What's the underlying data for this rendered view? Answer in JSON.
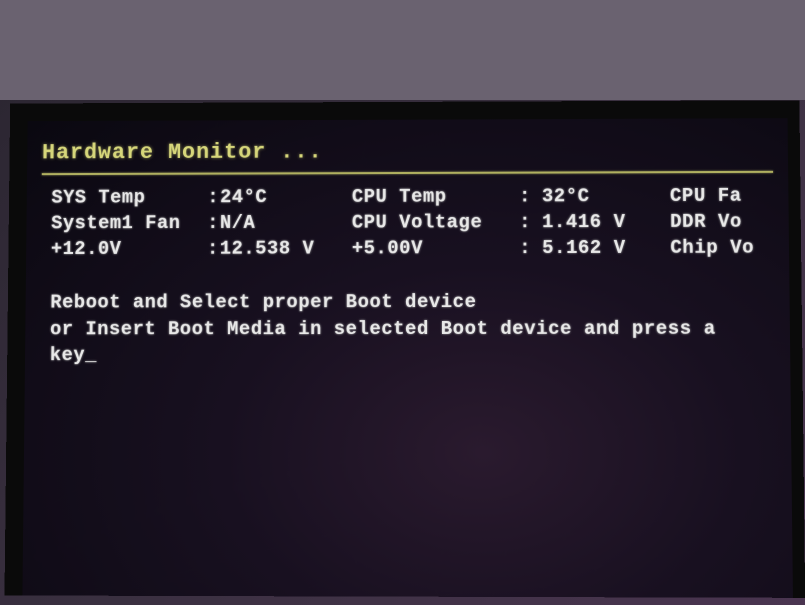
{
  "title": "Hardware Monitor ...",
  "row1": {
    "label1": "SYS Temp",
    "sep1": ":",
    "val1": "24°C",
    "label2": "CPU Temp",
    "sep2": ":",
    "val2": "32°C",
    "label3": "CPU Fa"
  },
  "row2": {
    "label1": "System1 Fan",
    "sep1": ":",
    "val1": "N/A",
    "label2": "CPU Voltage",
    "sep2": ":",
    "val2": "1.416 V",
    "label3": "DDR Vo"
  },
  "row3": {
    "label1": "+12.0V",
    "sep1": ":",
    "val1": "12.538 V",
    "label2": "+5.00V",
    "sep2": ":",
    "val2": "5.162 V",
    "label3": "Chip Vo"
  },
  "message": {
    "line1": "Reboot and Select proper Boot device",
    "line2": "or Insert Boot Media in selected Boot device and press a key_"
  }
}
